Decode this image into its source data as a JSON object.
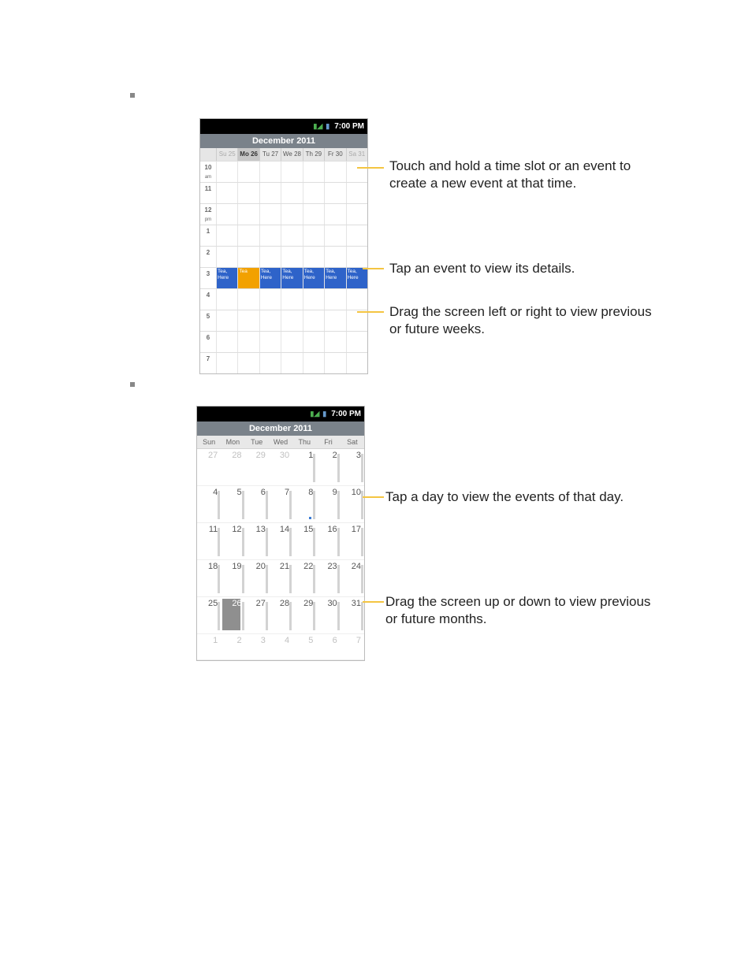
{
  "status": {
    "time": "7:00 PM"
  },
  "week": {
    "title": "December 2011",
    "days": [
      "Su 25",
      "Mo 26",
      "Tu 27",
      "We 28",
      "Th 29",
      "Fr 30",
      "Sa 31"
    ],
    "selected_index": 1,
    "hours": [
      {
        "h": "10",
        "ampm": "am"
      },
      {
        "h": "11",
        "ampm": ""
      },
      {
        "h": "12",
        "ampm": "pm"
      },
      {
        "h": "1",
        "ampm": ""
      },
      {
        "h": "2",
        "ampm": ""
      },
      {
        "h": "3",
        "ampm": ""
      },
      {
        "h": "4",
        "ampm": ""
      },
      {
        "h": "5",
        "ampm": ""
      },
      {
        "h": "6",
        "ampm": ""
      },
      {
        "h": "7",
        "ampm": ""
      }
    ],
    "event_row_index": 5,
    "event_label": "Tea, Here",
    "event_label_short": "Tea",
    "orange_index": 1
  },
  "month": {
    "title": "December 2011",
    "day_names": [
      "Sun",
      "Mon",
      "Tue",
      "Wed",
      "Thu",
      "Fri",
      "Sat"
    ],
    "rows": [
      {
        "cells": [
          {
            "n": "27",
            "fade": true
          },
          {
            "n": "28",
            "fade": true
          },
          {
            "n": "29",
            "fade": true
          },
          {
            "n": "30",
            "fade": true
          },
          {
            "n": "1"
          },
          {
            "n": "2"
          },
          {
            "n": "3"
          }
        ]
      },
      {
        "cells": [
          {
            "n": "4"
          },
          {
            "n": "5"
          },
          {
            "n": "6"
          },
          {
            "n": "7"
          },
          {
            "n": "8",
            "dot": true
          },
          {
            "n": "9"
          },
          {
            "n": "10"
          }
        ]
      },
      {
        "cells": [
          {
            "n": "11"
          },
          {
            "n": "12"
          },
          {
            "n": "13"
          },
          {
            "n": "14"
          },
          {
            "n": "15"
          },
          {
            "n": "16"
          },
          {
            "n": "17"
          }
        ]
      },
      {
        "cells": [
          {
            "n": "18"
          },
          {
            "n": "19"
          },
          {
            "n": "20"
          },
          {
            "n": "21"
          },
          {
            "n": "22"
          },
          {
            "n": "23"
          },
          {
            "n": "24"
          }
        ]
      },
      {
        "cells": [
          {
            "n": "25"
          },
          {
            "n": "26",
            "sel": true
          },
          {
            "n": "27"
          },
          {
            "n": "28"
          },
          {
            "n": "29"
          },
          {
            "n": "30"
          },
          {
            "n": "31"
          }
        ]
      },
      {
        "cells": [
          {
            "n": "1",
            "fade": true
          },
          {
            "n": "2",
            "fade": true
          },
          {
            "n": "3",
            "fade": true
          },
          {
            "n": "4",
            "fade": true
          },
          {
            "n": "5",
            "fade": true
          },
          {
            "n": "6",
            "fade": true
          },
          {
            "n": "7",
            "fade": true
          }
        ],
        "short": true
      }
    ]
  },
  "callouts": {
    "week_hold": "Touch and hold a time slot or an event to create a new event at that time.",
    "week_tap": "Tap an event to view its details.",
    "week_drag": "Drag the screen left or right to view previous or future weeks.",
    "month_tap": "Tap a day to view the events of that day.",
    "month_drag": "Drag the screen up or down to view previous or future months."
  }
}
